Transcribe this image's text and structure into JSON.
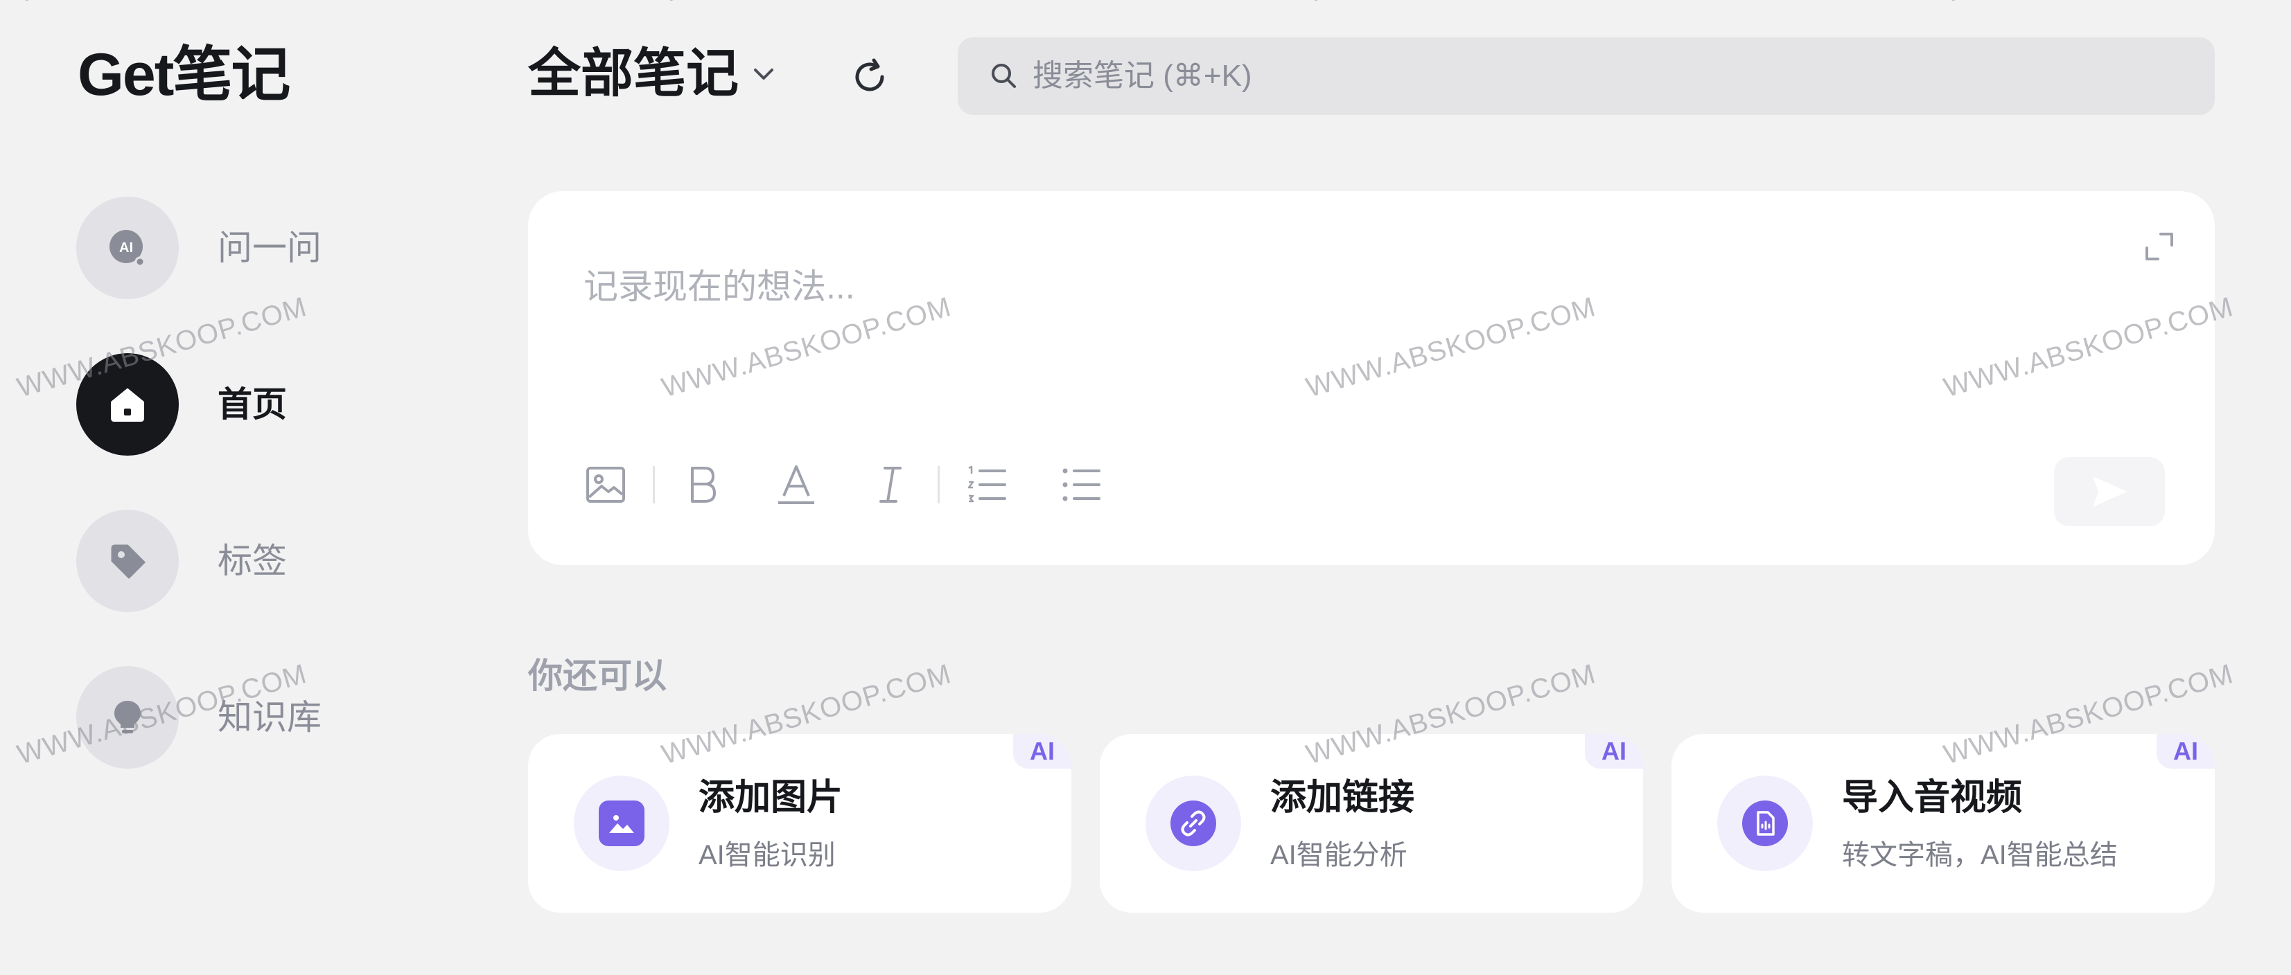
{
  "app": {
    "logo": "Get笔记"
  },
  "sidebar": {
    "items": [
      {
        "label": "问一问",
        "icon": "ai-chat-icon",
        "active": false
      },
      {
        "label": "首页",
        "icon": "home-icon",
        "active": true
      },
      {
        "label": "标签",
        "icon": "tag-icon",
        "active": false
      },
      {
        "label": "知识库",
        "icon": "lightbulb-icon",
        "active": false
      }
    ],
    "ai_badge": "AI"
  },
  "header": {
    "title": "全部笔记",
    "search_placeholder": "搜索笔记 (⌘+K)",
    "search_value": ""
  },
  "editor": {
    "placeholder": "记录现在的想法...",
    "toolbar": [
      "image-icon",
      "bold-icon",
      "text-color-icon",
      "italic-icon",
      "ordered-list-icon",
      "bullet-list-icon"
    ]
  },
  "also": {
    "title": "你还可以",
    "cards": [
      {
        "title": "添加图片",
        "subtitle": "AI智能识别",
        "badge": "AI",
        "icon": "image-icon"
      },
      {
        "title": "添加链接",
        "subtitle": "AI智能分析",
        "badge": "AI",
        "icon": "link-icon"
      },
      {
        "title": "导入音视频",
        "subtitle": "转文字稿，AI智能总结",
        "badge": "AI",
        "icon": "audio-file-icon"
      }
    ]
  },
  "watermark": "WWW.ABSKOOP.COM",
  "colors": {
    "accent": "#7a63e8",
    "accent_soft": "#f1effc",
    "dark": "#16181c",
    "background": "#f2f2f3"
  }
}
